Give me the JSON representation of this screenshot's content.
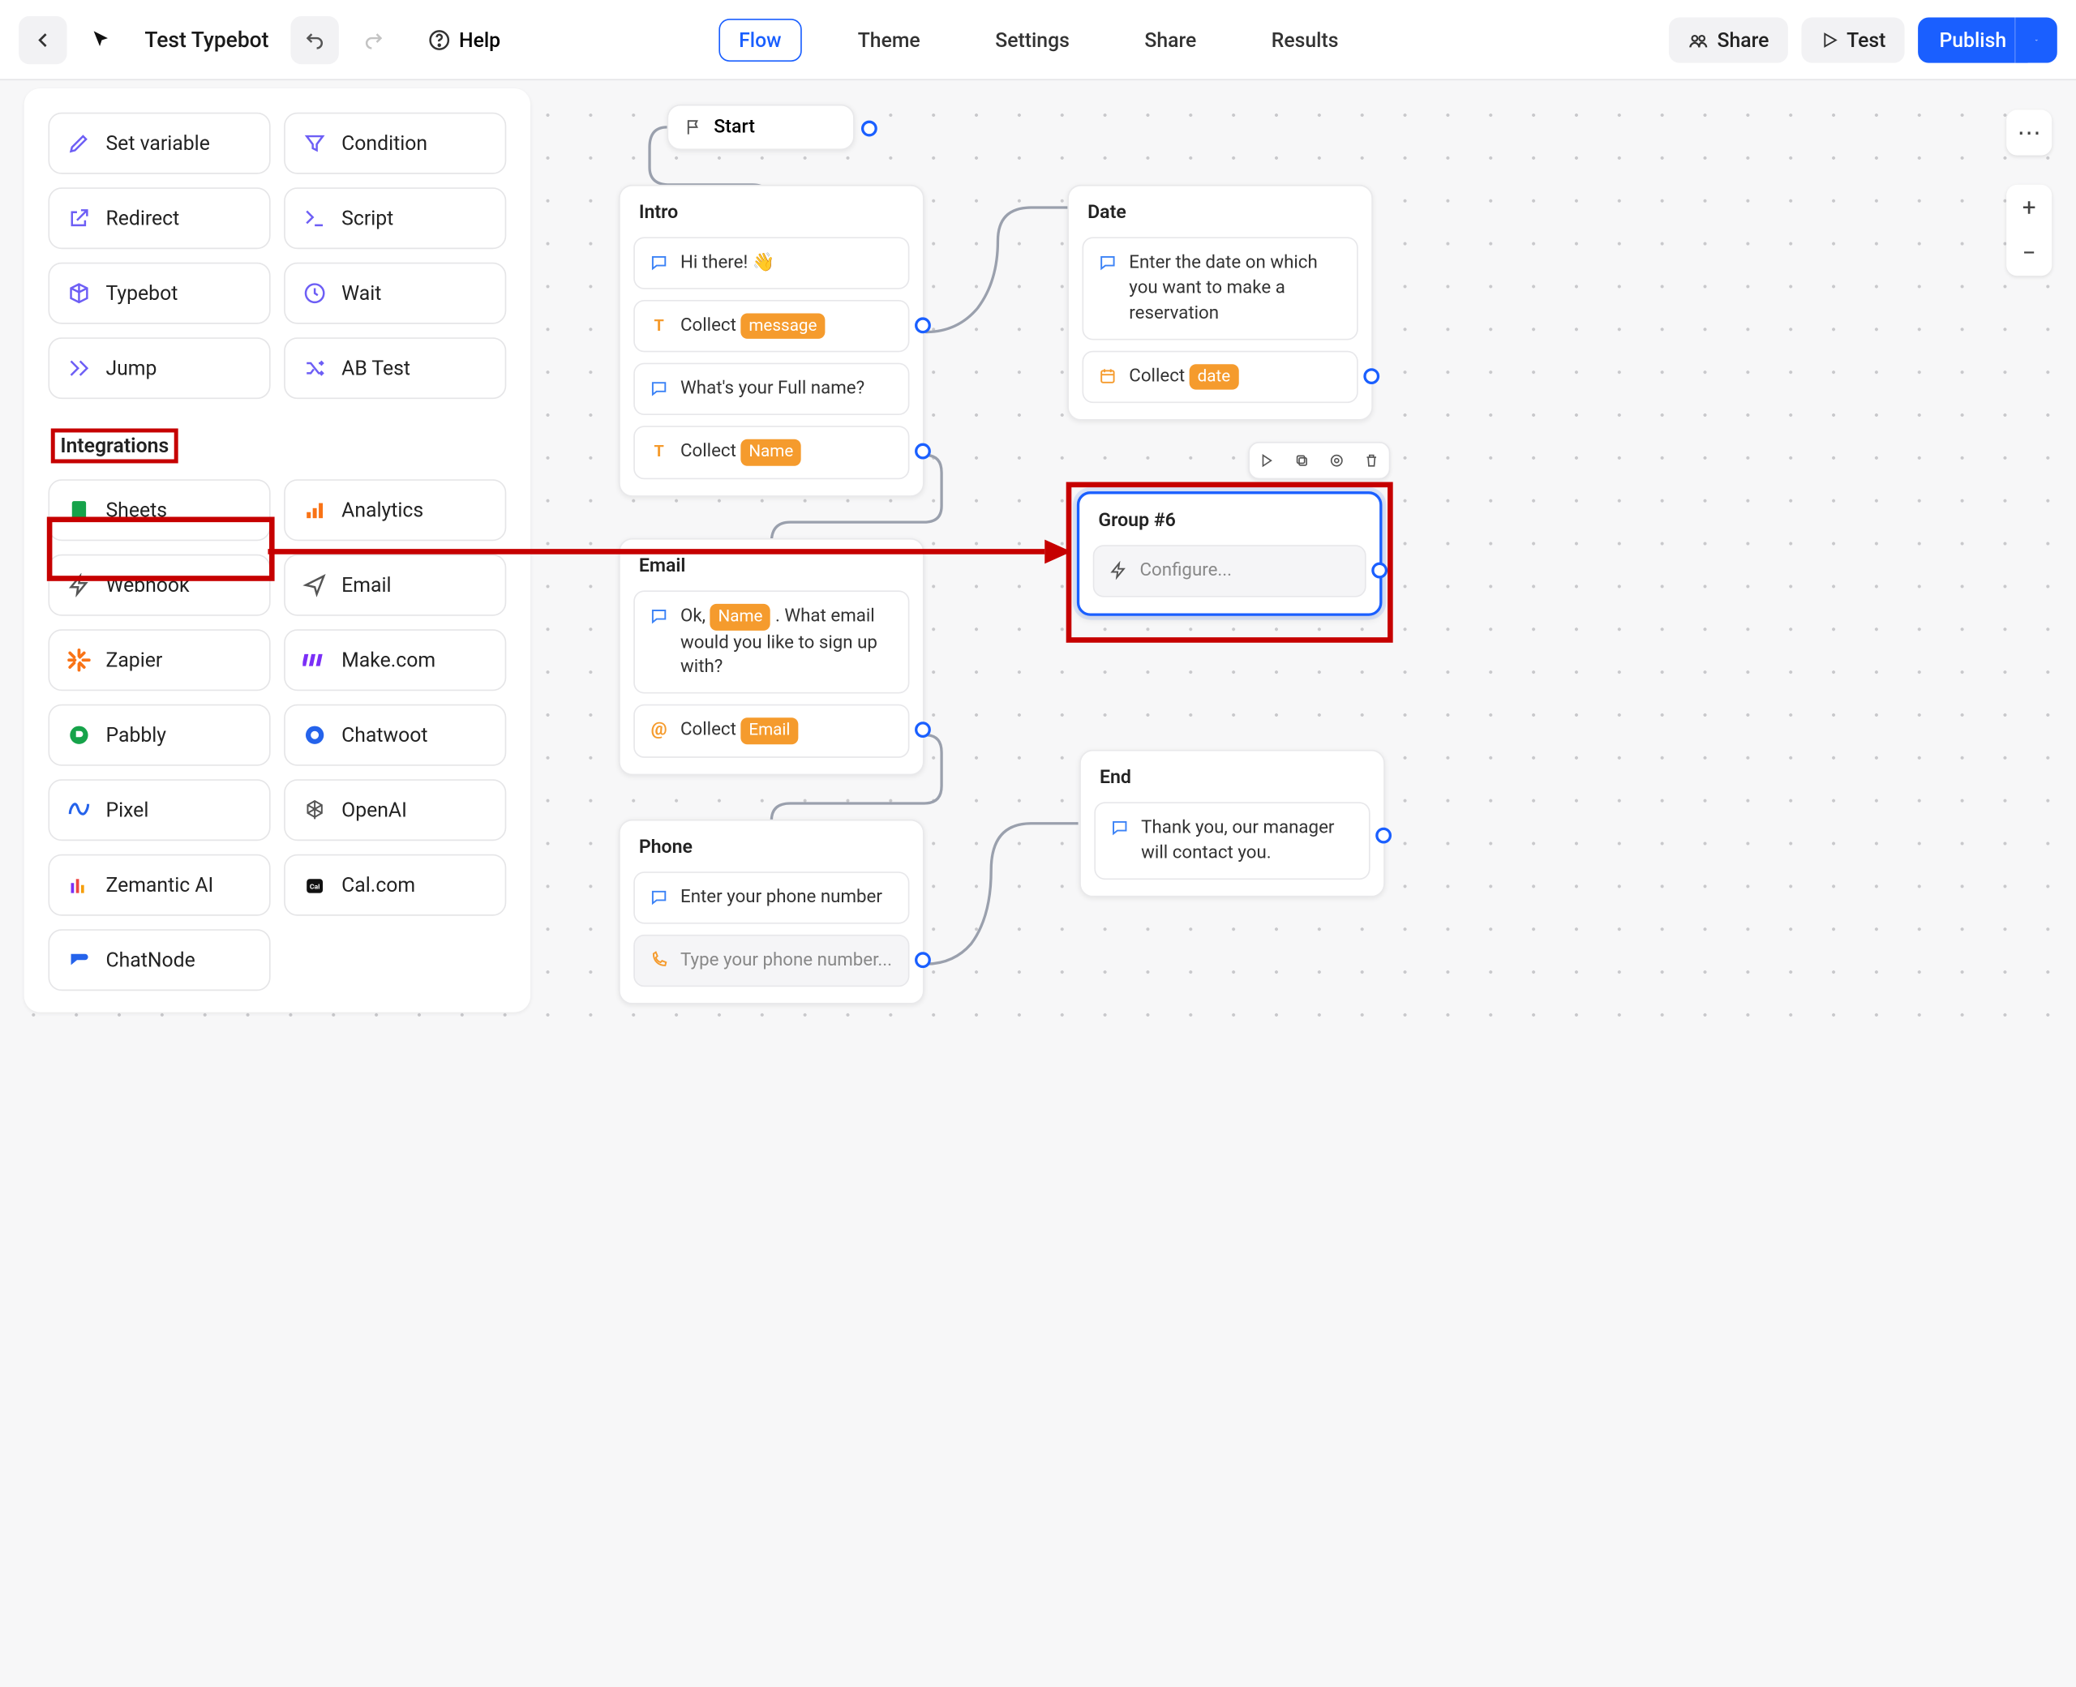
{
  "header": {
    "bot_name": "Test Typebot",
    "help": "Help",
    "tabs": {
      "flow": "Flow",
      "theme": "Theme",
      "settings": "Settings",
      "share": "Share",
      "results": "Results"
    },
    "share_btn": "Share",
    "test_btn": "Test",
    "publish_btn": "Publish"
  },
  "sidebar": {
    "logic": {
      "set_variable": "Set variable",
      "condition": "Condition",
      "redirect": "Redirect",
      "script": "Script",
      "typebot": "Typebot",
      "wait": "Wait",
      "jump": "Jump",
      "ab_test": "AB Test"
    },
    "integrations_title": "Integrations",
    "integrations": {
      "sheets": "Sheets",
      "analytics": "Analytics",
      "webhook": "Webhook",
      "email": "Email",
      "zapier": "Zapier",
      "make": "Make.com",
      "pabbly": "Pabbly",
      "chatwoot": "Chatwoot",
      "pixel": "Pixel",
      "openai": "OpenAI",
      "zemantic": "Zemantic AI",
      "cal": "Cal.com",
      "chatnode": "ChatNode"
    }
  },
  "canvas": {
    "start": "Start",
    "intro": {
      "title": "Intro",
      "hi": "Hi there!  ",
      "collect1a": "Collect ",
      "collect1b": "message",
      "fullname": "What's your Full name?",
      "collect2a": "Collect ",
      "collect2b": "Name"
    },
    "email": {
      "title": "Email",
      "line1a": "Ok, ",
      "line1b": "Name",
      "line1c": " . What email would you like to sign up with?",
      "collecta": "Collect ",
      "collectb": "Email"
    },
    "phone": {
      "title": "Phone",
      "line": "Enter your phone number",
      "placeholder": "Type your phone number..."
    },
    "date": {
      "title": "Date",
      "line": "Enter the date on which you want to make a reservation",
      "collecta": "Collect ",
      "collectb": "date"
    },
    "group6": {
      "title": "Group #6",
      "configure": "Configure..."
    },
    "end": {
      "title": "End",
      "line": "Thank you, our manager will contact you."
    }
  }
}
